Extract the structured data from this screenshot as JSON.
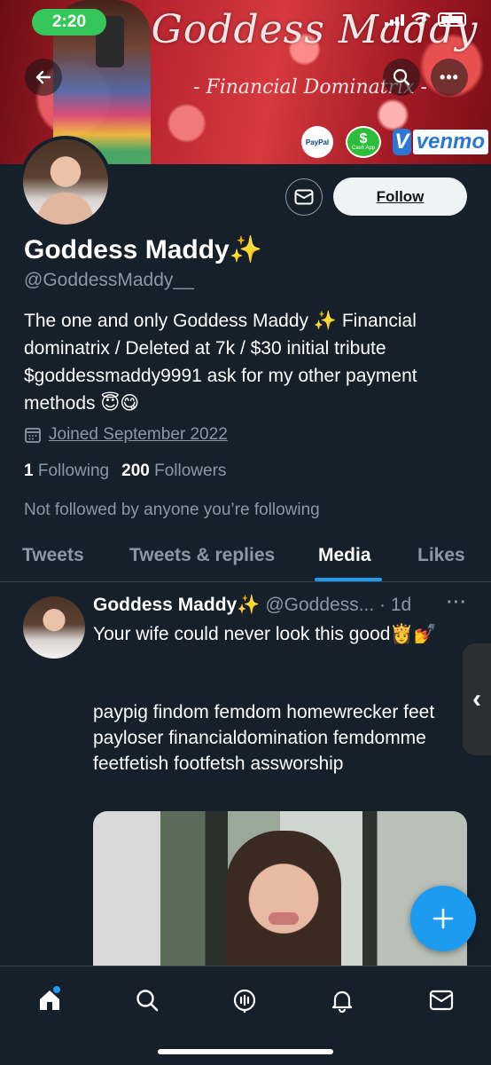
{
  "status_bar": {
    "time": "2:20"
  },
  "banner": {
    "title": "Goddess Maddy",
    "subtitle": "- Financial Dominatrix -",
    "payment_badges": [
      "PayPal",
      "Cash App",
      "venmo"
    ]
  },
  "profile": {
    "display_name": "Goddess Maddy✨",
    "handle": "@GoddessMaddy__",
    "bio": "The one and only Goddess Maddy ✨ Financial dominatrix / Deleted at 7k / $30 initial tribute $goddessmaddy9991 ask for my other payment methods 😇😋",
    "joined": "Joined September 2022",
    "following_count": "1",
    "following_label": "Following",
    "followers_count": "200",
    "followers_label": "Followers",
    "not_followed_text": "Not followed by anyone you’re following",
    "follow_button": "Follow"
  },
  "tabs": [
    {
      "label": "Tweets",
      "active": false
    },
    {
      "label": "Tweets & replies",
      "active": false
    },
    {
      "label": "Media",
      "active": true
    },
    {
      "label": "Likes",
      "active": false
    }
  ],
  "tweet": {
    "name": "Goddess Maddy✨",
    "meta": "@Goddess... · 1d",
    "text": "Your wife could never look this good👸💅",
    "hashtags": "paypig findom femdom homewrecker feet payloser  financialdomination femdomme  feetfetish footfetsh assworship"
  },
  "icons": {
    "back": "arrow-left-icon",
    "search": "search-icon",
    "more": "more-icon",
    "mail": "mail-icon",
    "calendar": "calendar-icon",
    "compose": "plus-icon",
    "side_tab": "chevron-left-icon",
    "nav": [
      "home-icon",
      "search-icon",
      "spaces-icon",
      "bell-icon",
      "mail-icon"
    ]
  },
  "colors": {
    "background": "#15202b",
    "accent": "#1d9bf0",
    "secondary_text": "#8b98a5",
    "status_pill": "#35c759"
  }
}
